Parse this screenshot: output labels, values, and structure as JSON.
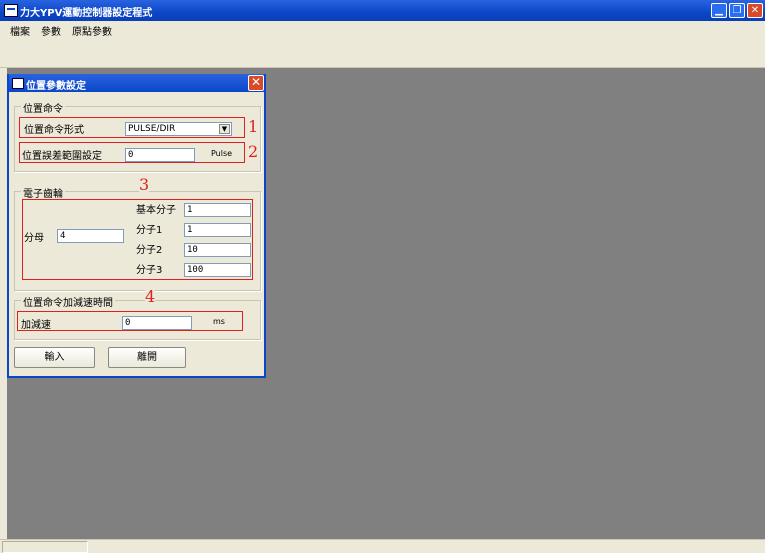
{
  "window": {
    "title": "力大YPV運動控制器設定程式"
  },
  "menu": [
    {
      "label": "檔案"
    },
    {
      "label": "參數"
    },
    {
      "label": "原點參數"
    }
  ],
  "dialog": {
    "title": "位置參數設定",
    "group1": {
      "label": "位置命令",
      "cmd_type_label": "位置命令形式",
      "cmd_type_value": "PULSE/DIR",
      "error_label": "位置誤差範圍設定",
      "error_value": "0",
      "error_unit": "Pulse",
      "marker1": "1",
      "marker2": "2"
    },
    "group2": {
      "label": "電子齒輪",
      "marker": "3",
      "denominator_label": "分母",
      "denominator_value": "4",
      "base_label": "基本分子",
      "base_value": "1",
      "num1_label": "分子1",
      "num1_value": "1",
      "num2_label": "分子2",
      "num2_value": "10",
      "num3_label": "分子3",
      "num3_value": "100"
    },
    "group3": {
      "label": "位置命令加減速時間",
      "marker": "4",
      "accel_label": "加減速",
      "accel_value": "0",
      "accel_unit": "ms"
    },
    "buttons": {
      "enter": "輸入",
      "exit": "離開"
    }
  },
  "colors": {
    "title_bar": "#0a47c8",
    "highlight": "#e02020",
    "workspace": "#808080"
  }
}
